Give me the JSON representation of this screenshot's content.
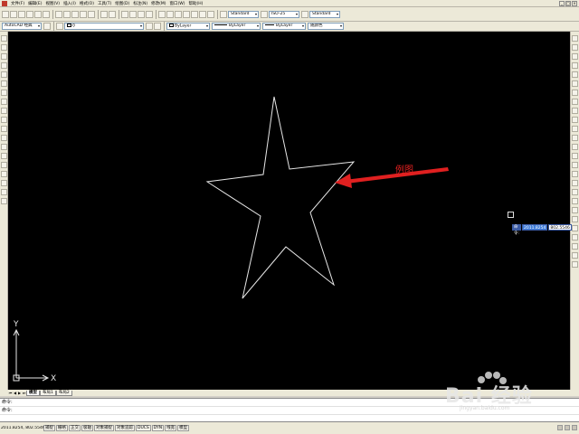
{
  "menu": {
    "items": [
      "文件(F)",
      "编辑(E)",
      "视图(V)",
      "插入(I)",
      "格式(O)",
      "工具(T)",
      "绘图(D)",
      "标注(N)",
      "修改(M)",
      "窗口(W)",
      "帮助(H)"
    ]
  },
  "toolbar": {
    "text_style": "Standard",
    "dim_style": "ISO-25",
    "table_style": "Standard",
    "workspace": "AutoCAD 经典",
    "color": "ByLayer",
    "linetype": "ByLayer",
    "lineweight": "ByLayer",
    "plotstyle": "随颜色"
  },
  "drawing": {
    "annotation_label": "例图",
    "ucs_x": "X",
    "ucs_y": "Y",
    "star_color": "#e6e6e6",
    "arrow_color": "#e02020"
  },
  "dynamic_input": {
    "label": "命令:",
    "x_value": "2011.8254",
    "y_value": "802.5546"
  },
  "tabs": {
    "items": [
      "模型",
      "布局1",
      "布局2"
    ],
    "active": "模型"
  },
  "command_line": {
    "line1": "命令:",
    "line2": "命令:"
  },
  "status": {
    "coords": "2011.8254, 802.5546 , 0.0000",
    "buttons": [
      "捕捉",
      "栅格",
      "正交",
      "极轴",
      "对象捕捉",
      "对象追踪",
      "DUCS",
      "DYN",
      "线宽",
      "模型"
    ]
  },
  "watermark": {
    "text": "Bai 经验",
    "sub": "jingyan.baidu.com"
  }
}
